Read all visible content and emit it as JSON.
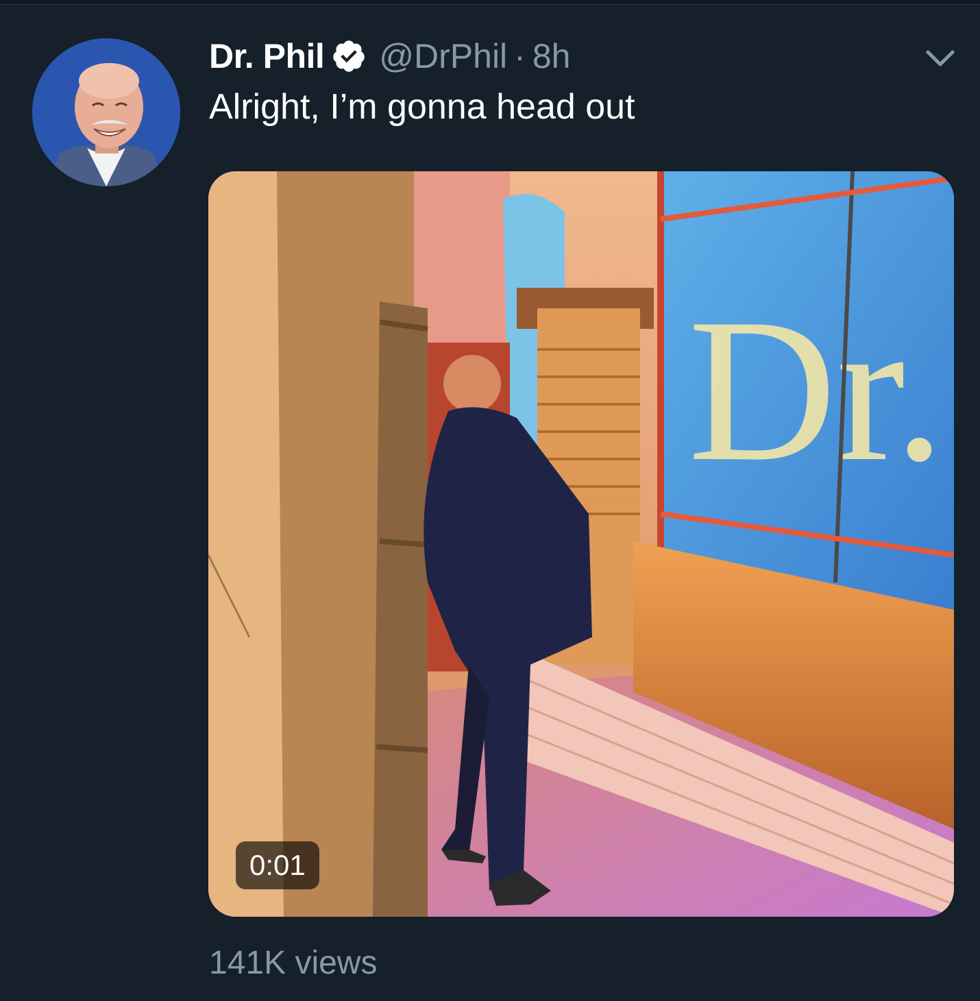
{
  "tweet": {
    "author": {
      "display_name": "Dr. Phil",
      "handle": "@DrPhil",
      "verified": true
    },
    "separator": "·",
    "timestamp": "8h",
    "text": "Alright, I’m gonna head out",
    "media": {
      "type": "video",
      "duration": "0:01"
    },
    "views": "141K views"
  },
  "icons": {
    "verified": "verified-badge-icon",
    "menu": "chevron-down-icon"
  },
  "colors": {
    "background": "#15202b",
    "primary_text": "#ffffff",
    "secondary_text": "#8899a6"
  }
}
